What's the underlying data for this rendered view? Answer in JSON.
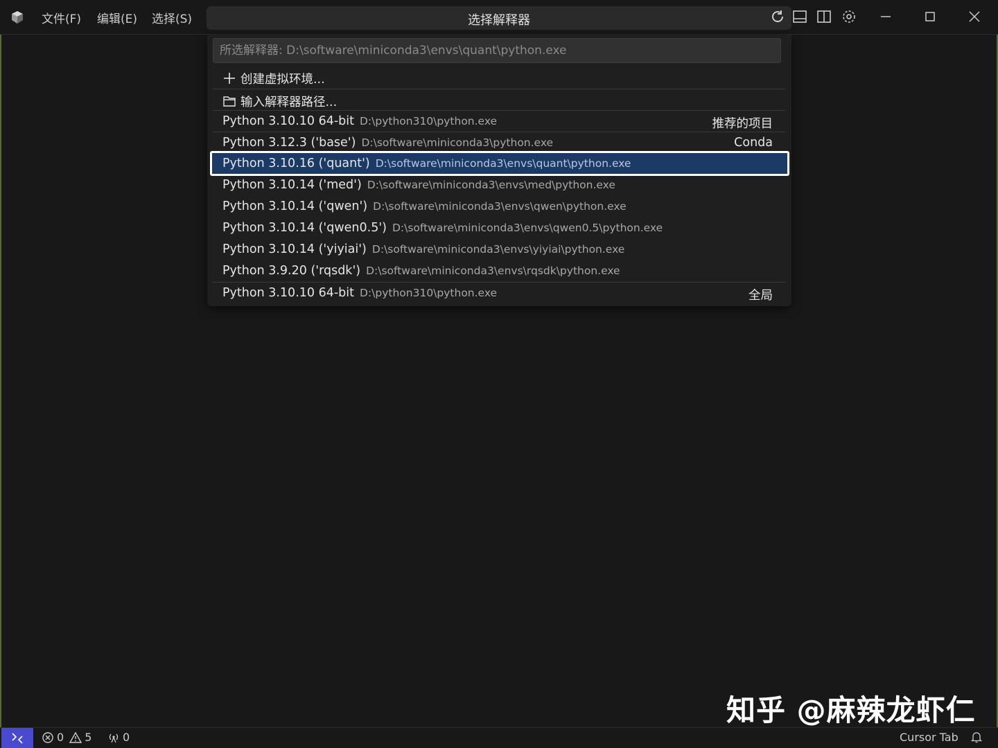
{
  "menu": {
    "file": "文件(F)",
    "edit": "编辑(E)",
    "select": "选择(S)"
  },
  "title": "选择解释器",
  "quickpick": {
    "placeholder": "所选解释器: D:\\software\\miniconda3\\envs\\quant\\python.exe",
    "actions": [
      {
        "label": "创建虚拟环境...",
        "icon": "plus-icon"
      },
      {
        "label": "输入解释器路径...",
        "icon": "folder-icon"
      }
    ],
    "items": [
      {
        "label": "Python 3.10.10 64-bit",
        "path": "D:\\python310\\python.exe",
        "tag": "推荐的项目"
      },
      {
        "label": "Python 3.12.3 ('base')",
        "path": "D:\\software\\miniconda3\\python.exe",
        "tag": "Conda"
      },
      {
        "label": "Python 3.10.16 ('quant')",
        "path": "D:\\software\\miniconda3\\envs\\quant\\python.exe",
        "tag": ""
      },
      {
        "label": "Python 3.10.14 ('med')",
        "path": "D:\\software\\miniconda3\\envs\\med\\python.exe",
        "tag": ""
      },
      {
        "label": "Python 3.10.14 ('qwen')",
        "path": "D:\\software\\miniconda3\\envs\\qwen\\python.exe",
        "tag": ""
      },
      {
        "label": "Python 3.10.14 ('qwen0.5')",
        "path": "D:\\software\\miniconda3\\envs\\qwen0.5\\python.exe",
        "tag": ""
      },
      {
        "label": "Python 3.10.14 ('yiyiai')",
        "path": "D:\\software\\miniconda3\\envs\\yiyiai\\python.exe",
        "tag": ""
      },
      {
        "label": "Python 3.9.20 ('rqsdk')",
        "path": "D:\\software\\miniconda3\\envs\\rqsdk\\python.exe",
        "tag": ""
      }
    ],
    "global_item": {
      "label": "Python 3.10.10 64-bit",
      "path": "D:\\python310\\python.exe",
      "tag": "全局"
    }
  },
  "watermark": "知乎 @麻辣龙虾仁",
  "statusbar": {
    "errors": "0",
    "warnings": "5",
    "ports": "0",
    "cursor_tab": "Cursor Tab"
  },
  "colors": {
    "background": "#181818",
    "selection": "#1c3a66",
    "remote_button": "#4a4ad0"
  }
}
